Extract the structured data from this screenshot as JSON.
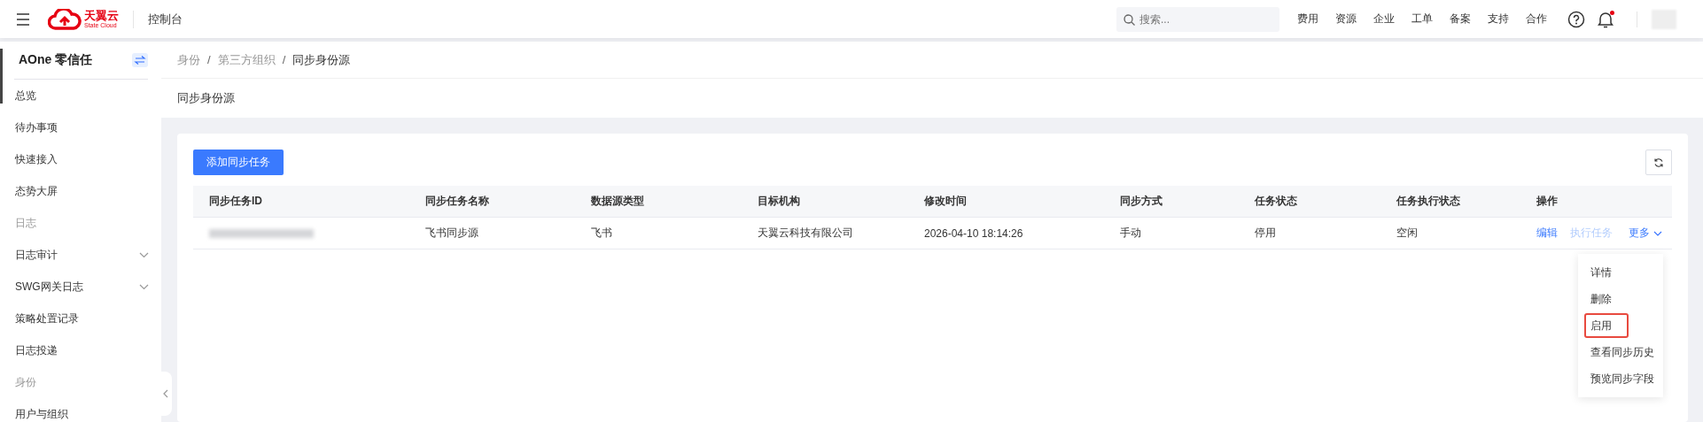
{
  "topbar": {
    "logo_text": "天翼云",
    "logo_subtext": "State Cloud",
    "console": "控制台",
    "search": {
      "placeholder": "搜索..."
    },
    "nav": [
      "费用",
      "资源",
      "企业",
      "工单",
      "备案",
      "支持",
      "合作"
    ],
    "notification_dot": true
  },
  "sidebar": {
    "title": "AOne 零信任",
    "items": [
      {
        "kind": "item",
        "label": "总览",
        "expandable": false
      },
      {
        "kind": "item",
        "label": "待办事项",
        "expandable": false
      },
      {
        "kind": "item",
        "label": "快速接入",
        "expandable": false
      },
      {
        "kind": "item",
        "label": "态势大屏",
        "expandable": false
      },
      {
        "kind": "group",
        "label": "日志",
        "expandable": false
      },
      {
        "kind": "item",
        "label": "日志审计",
        "expandable": true
      },
      {
        "kind": "item",
        "label": "SWG网关日志",
        "expandable": true
      },
      {
        "kind": "item",
        "label": "策略处置记录",
        "expandable": false
      },
      {
        "kind": "item",
        "label": "日志投递",
        "expandable": false
      },
      {
        "kind": "group",
        "label": "身份",
        "expandable": false
      },
      {
        "kind": "item",
        "label": "用户与组织",
        "expandable": false
      }
    ]
  },
  "breadcrumb_separator": "/",
  "breadcrumb": [
    {
      "label": "身份",
      "current": false
    },
    {
      "label": "第三方组织",
      "current": false
    },
    {
      "label": "同步身份源",
      "current": true
    }
  ],
  "page_title": "同步身份源",
  "add_button": "添加同步任务",
  "table": {
    "columns": [
      "同步任务ID",
      "同步任务名称",
      "数据源类型",
      "目标机构",
      "修改时间",
      "同步方式",
      "任务状态",
      "任务执行状态",
      "操作"
    ],
    "rows": [
      {
        "cells": [
          "",
          "飞书同步源",
          "飞书",
          "天翼云科技有限公司",
          "2026-04-10 18:14:26",
          "手动",
          "停用",
          "空闲"
        ],
        "actions": [
          {
            "label": "编辑",
            "disabled": false
          },
          {
            "label": "执行任务",
            "disabled": true
          }
        ],
        "more": "更多"
      }
    ]
  },
  "more_menu": [
    {
      "label": "详情",
      "highlighted": false
    },
    {
      "label": "删除",
      "highlighted": false
    },
    {
      "label": "启用",
      "highlighted": true
    },
    {
      "label": "查看同步历史",
      "highlighted": false
    },
    {
      "label": "预览同步字段",
      "highlighted": false
    }
  ]
}
